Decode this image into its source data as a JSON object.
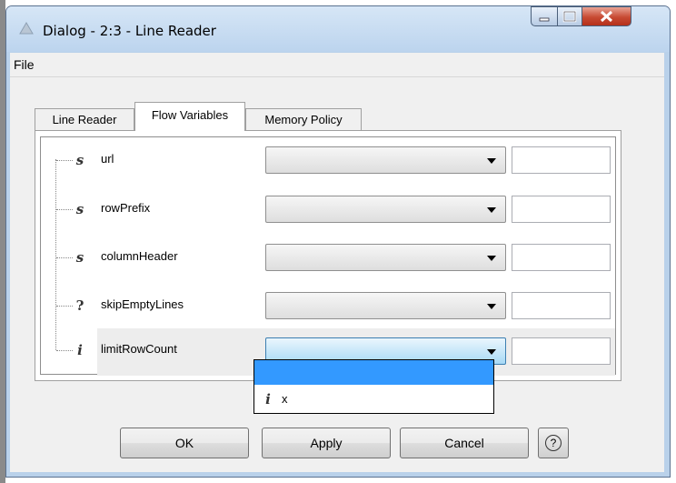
{
  "window": {
    "title": "Dialog - 2:3 - Line Reader"
  },
  "menu": {
    "file": "File"
  },
  "tabs": [
    {
      "label": "Line Reader"
    },
    {
      "label": "Flow Variables",
      "selected": true
    },
    {
      "label": "Memory Policy"
    }
  ],
  "variables": [
    {
      "type_icon": "s",
      "name": "url",
      "selected_value": "",
      "text_value": ""
    },
    {
      "type_icon": "s",
      "name": "rowPrefix",
      "selected_value": "",
      "text_value": ""
    },
    {
      "type_icon": "s",
      "name": "columnHeader",
      "selected_value": "",
      "text_value": ""
    },
    {
      "type_icon": "?",
      "name": "skipEmptyLines",
      "selected_value": "",
      "text_value": ""
    },
    {
      "type_icon": "i",
      "name": "limitRowCount",
      "selected_value": "",
      "text_value": ""
    }
  ],
  "dropdown_options": [
    {
      "label": ""
    },
    {
      "icon": "i",
      "label": "x"
    }
  ],
  "buttons": {
    "ok": "OK",
    "apply": "Apply",
    "cancel": "Cancel",
    "help": "?"
  },
  "colors": {
    "highlight": "#3399ff",
    "close_button": "#c74a33"
  }
}
